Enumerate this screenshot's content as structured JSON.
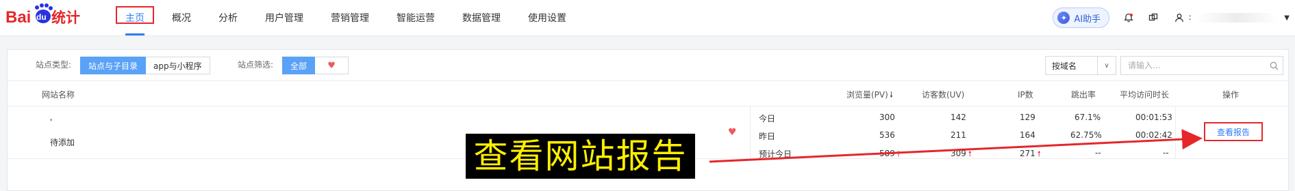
{
  "brand": {
    "logo_text_left": "Bai",
    "logo_text_du": "du",
    "logo_text_right": "统计",
    "accent": "#2f7cf6",
    "logo_red": "#e5262b",
    "logo_blue": "#2932e1"
  },
  "nav": {
    "items": [
      "主页",
      "概况",
      "分析",
      "用户管理",
      "营销管理",
      "智能运营",
      "数据管理",
      "使用设置"
    ],
    "active_index": 0
  },
  "header_tools": {
    "ai_label": "AI助手",
    "ai_icon": "ai-sparkle-icon",
    "bell_icon": "bell-icon",
    "layers_icon": "layers-icon",
    "user_icon": "user-icon",
    "user_name_initial": "∶"
  },
  "filters": {
    "site_type_label": "站点类型:",
    "site_type_options": [
      "站点与子目录",
      "app与小程序"
    ],
    "site_type_selected": 0,
    "site_filter_label": "站点筛选:",
    "site_filter_all": "全部",
    "site_filter_heart": "♥",
    "domain_select": "按域名",
    "search_placeholder": "请输入..."
  },
  "table": {
    "headers": {
      "site_name": "网站名称",
      "pv": "浏览量(PV)",
      "uv": "访客数(UV)",
      "ip": "IP数",
      "bounce": "跳出率",
      "avg_time": "平均访问时长",
      "actions": "操作"
    },
    "sort_icon": "arrow-down-icon",
    "row": {
      "site_mark": "'",
      "site_status": "待添加",
      "favorited": true,
      "periods": [
        {
          "label": "今日",
          "pv": "300",
          "uv": "142",
          "ip": "129",
          "bounce": "67.1%",
          "avg_time": "00:01:53"
        },
        {
          "label": "昨日",
          "pv": "536",
          "uv": "211",
          "ip": "164",
          "bounce": "62.75%",
          "avg_time": "00:02:42"
        },
        {
          "label": "预计今日",
          "pv": "589",
          "uv": "309",
          "ip": "271",
          "bounce": "--",
          "avg_time": "--"
        }
      ],
      "report_button": "查看报告"
    }
  },
  "annotation": {
    "banner_text": "查看网站报告",
    "banner_bg": "#000000",
    "banner_fg": "#ffef00",
    "arrow_color": "#e5262b"
  }
}
